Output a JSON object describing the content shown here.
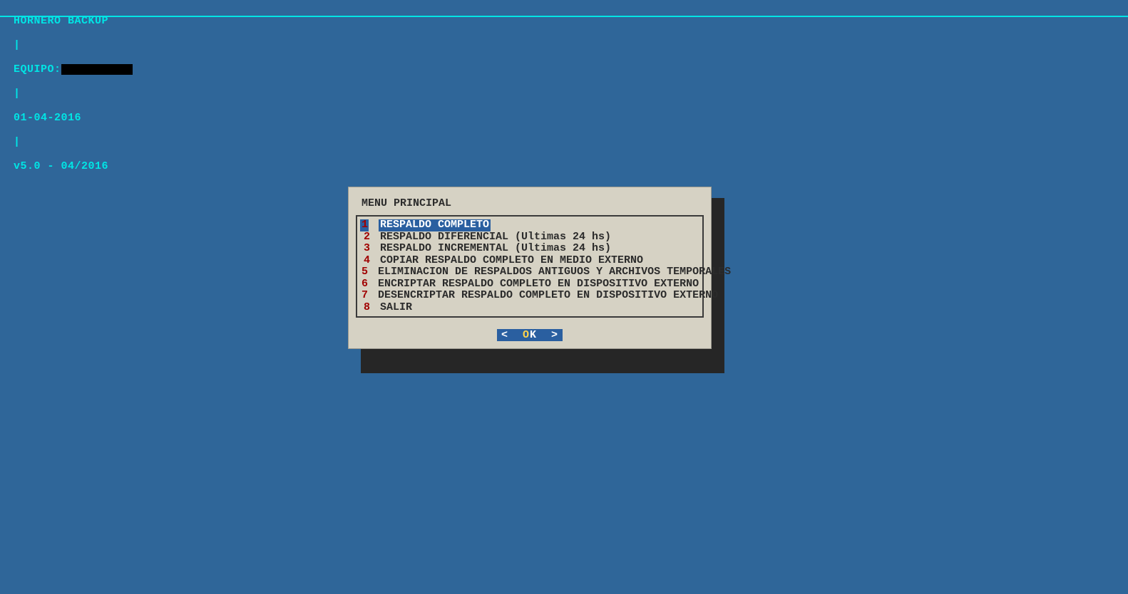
{
  "topbar": {
    "app_name": "HORNERO BACKUP",
    "equipo_label": "EQUIPO:",
    "equipo_value": "",
    "date": "01-04-2016",
    "version": "v5.0 - 04/2016",
    "separator": "|"
  },
  "dialog": {
    "title": "MENU PRINCIPAL",
    "items": [
      {
        "num": "1",
        "label": "RESPALDO COMPLETO",
        "selected": true
      },
      {
        "num": "2",
        "label": "RESPALDO DIFERENCIAL (Ultimas 24 hs)",
        "selected": false
      },
      {
        "num": "3",
        "label": "RESPALDO INCREMENTAL (Ultimas 24 hs)",
        "selected": false
      },
      {
        "num": "4",
        "label": "COPIAR RESPALDO COMPLETO EN MEDIO EXTERNO",
        "selected": false
      },
      {
        "num": "5",
        "label": "ELIMINACION DE RESPALDOS ANTIGUOS Y ARCHIVOS TEMPORALES",
        "selected": false
      },
      {
        "num": "6",
        "label": "ENCRIPTAR RESPALDO COMPLETO EN DISPOSITIVO EXTERNO",
        "selected": false
      },
      {
        "num": "7",
        "label": "DESENCRIPTAR RESPALDO COMPLETO EN DISPOSITIVO EXTERNO",
        "selected": false
      },
      {
        "num": "8",
        "label": "SALIR",
        "selected": false
      }
    ],
    "ok": {
      "left": "<  ",
      "o": "O",
      "k": "K",
      "right": "  >"
    }
  }
}
